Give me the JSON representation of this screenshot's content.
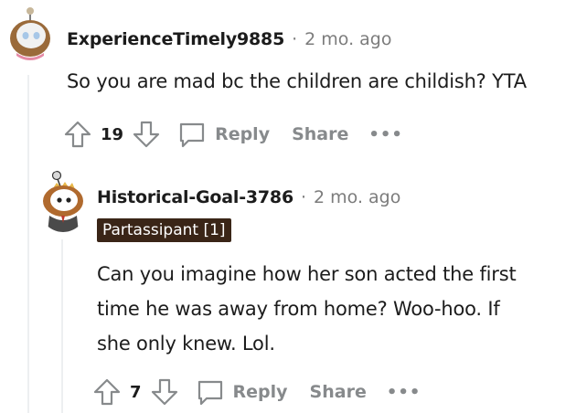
{
  "comments": [
    {
      "author": "ExperienceTimely9885",
      "separator": "·",
      "time": "2 mo. ago",
      "body": "So you are mad bc the children are childish? YTA",
      "votes": "19",
      "reply_label": "Reply",
      "share_label": "Share",
      "more_label": "•••",
      "avatar_icon": "snoo-avatar-icon"
    },
    {
      "author": "Historical-Goal-3786",
      "separator": "·",
      "time": "2 mo. ago",
      "flair": "Partassipant [1]",
      "body_lines": [
        "Can you imagine how her son acted the first",
        "time he was away from home? Woo-hoo. If",
        "she only knew. Lol."
      ],
      "votes": "7",
      "reply_label": "Reply",
      "share_label": "Share",
      "more_label": "•••",
      "avatar_icon": "snoo-avatar-icon"
    }
  ],
  "colors": {
    "flair_bg": "#3a2517",
    "meta_gray": "#7c7c7c",
    "action_gray": "#878a8c",
    "thread_line": "#edeff1"
  }
}
